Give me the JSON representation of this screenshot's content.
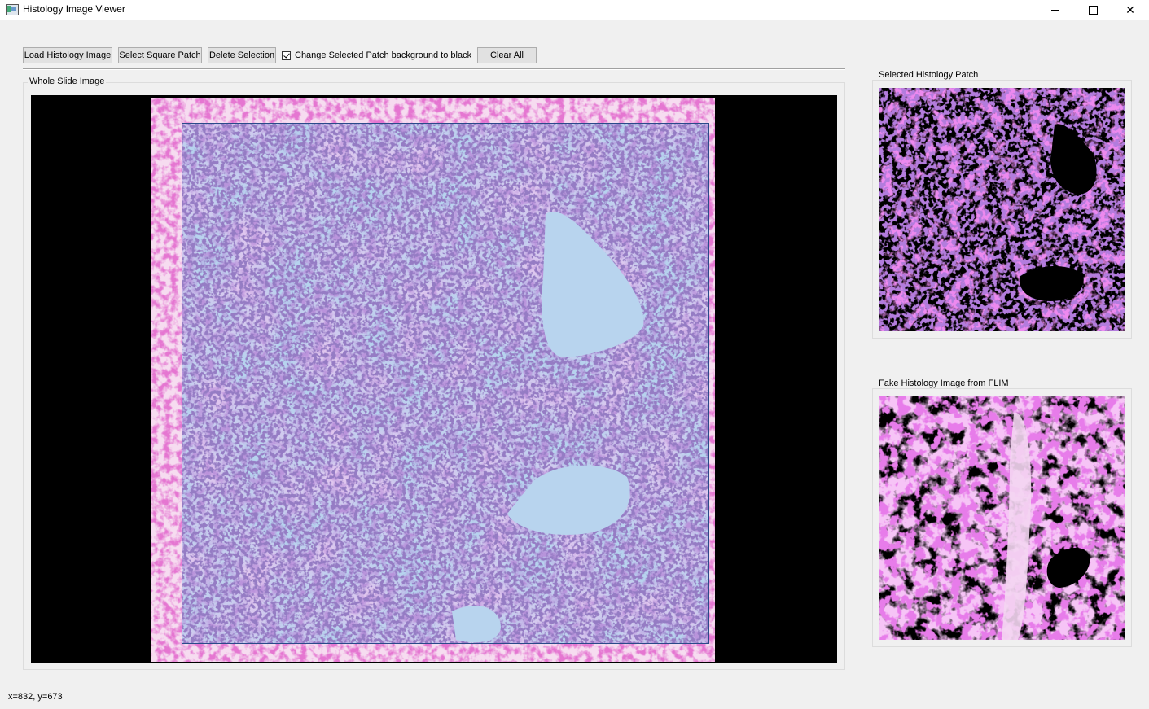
{
  "window": {
    "title": "Histology Image Viewer",
    "controls": {
      "minimize": "minimize",
      "maximize": "maximize",
      "close": "close"
    }
  },
  "toolbar": {
    "load_label": "Load Histology Image",
    "select_label": "Select Square Patch",
    "delete_label": "Delete Selection",
    "checkbox_label": "Change Selected Patch background to black",
    "checkbox_checked": true,
    "clear_label": "Clear All"
  },
  "panels": {
    "whole_slide_title": "Whole Slide Image",
    "selected_patch_title": "Selected Histology Patch",
    "fake_histology_title": "Fake Histology Image from FLIM"
  },
  "status": {
    "cursor": "x=832, y=673"
  },
  "colors": {
    "window_bg": "#f0f0f0",
    "view_bg": "#000000",
    "tissue_pink": "#d36ad0",
    "tissue_purple": "#7b4fb0",
    "selection_overlay": "#b4d2f0",
    "selection_border": "#2a4a8a"
  }
}
